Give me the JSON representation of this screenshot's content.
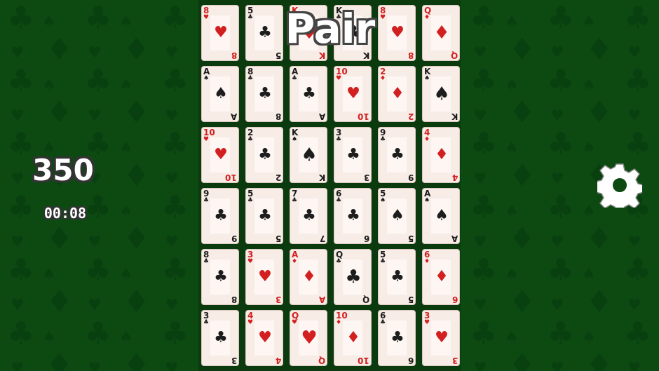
{
  "title": "Pair",
  "score": "350",
  "timer": "00:08",
  "colors": {
    "felt": "#0c4a12",
    "felt_pattern": "#09400f",
    "card_red": "#d21f1f",
    "card_black": "#1d1d1d"
  },
  "icons": {
    "settings": "gear-icon"
  },
  "cards": [
    {
      "rank": "8",
      "suit": "♥",
      "color": "red",
      "face": false
    },
    {
      "rank": "5",
      "suit": "♣",
      "color": "black",
      "face": false
    },
    {
      "rank": "K",
      "suit": "♥",
      "color": "red",
      "face": true
    },
    {
      "rank": "K",
      "suit": "♣",
      "color": "black",
      "face": true
    },
    {
      "rank": "8",
      "suit": "♥",
      "color": "red",
      "face": false
    },
    {
      "rank": "Q",
      "suit": "♦",
      "color": "red",
      "face": true
    },
    {
      "rank": "A",
      "suit": "♠",
      "color": "black",
      "face": false
    },
    {
      "rank": "8",
      "suit": "♣",
      "color": "black",
      "face": false
    },
    {
      "rank": "A",
      "suit": "♣",
      "color": "black",
      "face": false
    },
    {
      "rank": "10",
      "suit": "♥",
      "color": "red",
      "face": false
    },
    {
      "rank": "2",
      "suit": "♦",
      "color": "red",
      "face": false
    },
    {
      "rank": "K",
      "suit": "♠",
      "color": "black",
      "face": true
    },
    {
      "rank": "10",
      "suit": "♥",
      "color": "red",
      "face": false
    },
    {
      "rank": "2",
      "suit": "♣",
      "color": "black",
      "face": false
    },
    {
      "rank": "K",
      "suit": "♠",
      "color": "black",
      "face": true
    },
    {
      "rank": "3",
      "suit": "♣",
      "color": "black",
      "face": false
    },
    {
      "rank": "9",
      "suit": "♣",
      "color": "black",
      "face": false
    },
    {
      "rank": "4",
      "suit": "♦",
      "color": "red",
      "face": false
    },
    {
      "rank": "9",
      "suit": "♣",
      "color": "black",
      "face": false
    },
    {
      "rank": "5",
      "suit": "♣",
      "color": "black",
      "face": false
    },
    {
      "rank": "7",
      "suit": "♣",
      "color": "black",
      "face": false
    },
    {
      "rank": "6",
      "suit": "♣",
      "color": "black",
      "face": false
    },
    {
      "rank": "5",
      "suit": "♠",
      "color": "black",
      "face": false
    },
    {
      "rank": "A",
      "suit": "♠",
      "color": "black",
      "face": false
    },
    {
      "rank": "8",
      "suit": "♣",
      "color": "black",
      "face": false
    },
    {
      "rank": "3",
      "suit": "♥",
      "color": "red",
      "face": false
    },
    {
      "rank": "A",
      "suit": "♦",
      "color": "red",
      "face": false
    },
    {
      "rank": "Q",
      "suit": "♣",
      "color": "black",
      "face": true
    },
    {
      "rank": "5",
      "suit": "♣",
      "color": "black",
      "face": false
    },
    {
      "rank": "6",
      "suit": "♦",
      "color": "red",
      "face": false
    },
    {
      "rank": "3",
      "suit": "♣",
      "color": "black",
      "face": false
    },
    {
      "rank": "4",
      "suit": "♥",
      "color": "red",
      "face": false
    },
    {
      "rank": "Q",
      "suit": "♥",
      "color": "red",
      "face": true
    },
    {
      "rank": "10",
      "suit": "♦",
      "color": "red",
      "face": false
    },
    {
      "rank": "6",
      "suit": "♣",
      "color": "black",
      "face": false
    },
    {
      "rank": "3",
      "suit": "♥",
      "color": "red",
      "face": false
    }
  ]
}
